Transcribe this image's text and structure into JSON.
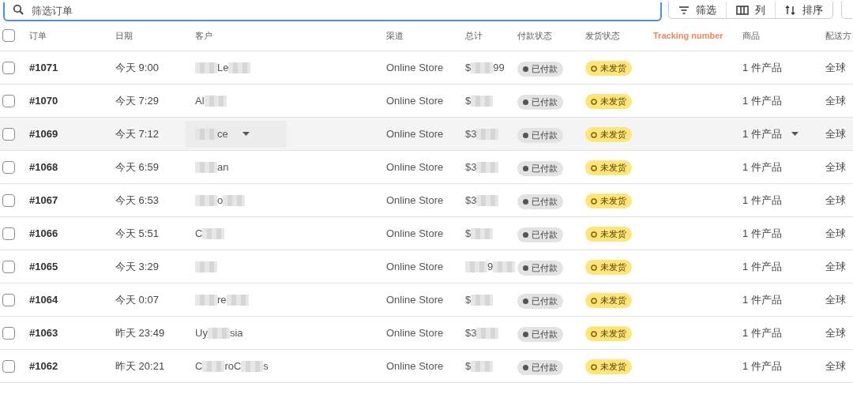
{
  "toolbar": {
    "search": {
      "placeholder": "筛选订单"
    },
    "buttons": [
      {
        "kind": "filter",
        "label": "筛选"
      },
      {
        "kind": "columns",
        "label": "列"
      },
      {
        "kind": "sort",
        "label": "排序"
      },
      {
        "kind": "more"
      }
    ]
  },
  "table": {
    "select_all": {
      "checked": false
    },
    "columns": [
      {
        "label": "订单",
        "highlight": false
      },
      {
        "label": "日期",
        "highlight": false
      },
      {
        "label": "客户",
        "highlight": false
      },
      {
        "label": "渠道",
        "highlight": false
      },
      {
        "label": "总计",
        "highlight": false
      },
      {
        "label": "付款状态",
        "highlight": false
      },
      {
        "label": "发货状态",
        "highlight": false
      },
      {
        "label": "Tracking number",
        "highlight": true
      },
      {
        "label": "商品",
        "highlight": false
      },
      {
        "label": "配送方",
        "highlight": false
      }
    ],
    "rows": [
      {
        "order": "#1071",
        "date": "今天 9:00",
        "customer": [
          {
            "kind": "blur"
          },
          {
            "kind": "text",
            "text": "Le"
          },
          {
            "kind": "blur"
          }
        ],
        "channel": "Online Store",
        "total": [
          {
            "kind": "text",
            "text": "$"
          },
          {
            "kind": "blur"
          },
          {
            "kind": "text",
            "text": "99"
          }
        ],
        "payment": "已付款",
        "fulfillment": "未发货",
        "items": "1 件产品",
        "shipping": "全球",
        "hovered": false,
        "checked": false
      },
      {
        "order": "#1070",
        "date": "今天 7:29",
        "customer": [
          {
            "kind": "text",
            "text": "Al"
          },
          {
            "kind": "blur"
          }
        ],
        "channel": "Online Store",
        "total": [
          {
            "kind": "text",
            "text": "$"
          },
          {
            "kind": "blur"
          }
        ],
        "payment": "已付款",
        "fulfillment": "未发货",
        "items": "1 件产品",
        "shipping": "全球",
        "hovered": false,
        "checked": false
      },
      {
        "order": "#1069",
        "date": "今天 7:12",
        "customer": [
          {
            "kind": "blur"
          },
          {
            "kind": "text",
            "text": "ce"
          }
        ],
        "channel": "Online Store",
        "total": [
          {
            "kind": "text",
            "text": "$3"
          },
          {
            "kind": "blur"
          }
        ],
        "payment": "已付款",
        "fulfillment": "未发货",
        "items": "1 件产品",
        "shipping": "全球",
        "hovered": true,
        "checked": false
      },
      {
        "order": "#1068",
        "date": "今天 6:59",
        "customer": [
          {
            "kind": "blur"
          },
          {
            "kind": "text",
            "text": "an"
          }
        ],
        "channel": "Online Store",
        "total": [
          {
            "kind": "text",
            "text": "$3"
          },
          {
            "kind": "blur"
          }
        ],
        "payment": "已付款",
        "fulfillment": "未发货",
        "items": "1 件产品",
        "shipping": "全球",
        "hovered": false,
        "checked": false
      },
      {
        "order": "#1067",
        "date": "今天 6:53",
        "customer": [
          {
            "kind": "blur"
          },
          {
            "kind": "text",
            "text": "o"
          },
          {
            "kind": "blur"
          }
        ],
        "channel": "Online Store",
        "total": [
          {
            "kind": "text",
            "text": "$3"
          },
          {
            "kind": "blur"
          }
        ],
        "payment": "已付款",
        "fulfillment": "未发货",
        "items": "1 件产品",
        "shipping": "全球",
        "hovered": false,
        "checked": false
      },
      {
        "order": "#1066",
        "date": "今天 5:51",
        "customer": [
          {
            "kind": "text",
            "text": "C"
          },
          {
            "kind": "blur"
          }
        ],
        "channel": "Online Store",
        "total": [
          {
            "kind": "text",
            "text": "$"
          },
          {
            "kind": "blur"
          }
        ],
        "payment": "已付款",
        "fulfillment": "未发货",
        "items": "1 件产品",
        "shipping": "全球",
        "hovered": false,
        "checked": false
      },
      {
        "order": "#1065",
        "date": "今天 3:29",
        "customer": [
          {
            "kind": "blur"
          }
        ],
        "channel": "Online Store",
        "total": [
          {
            "kind": "blur"
          },
          {
            "kind": "text",
            "text": "9"
          },
          {
            "kind": "blur"
          }
        ],
        "payment": "已付款",
        "fulfillment": "未发货",
        "items": "1 件产品",
        "shipping": "全球",
        "hovered": false,
        "checked": false
      },
      {
        "order": "#1064",
        "date": "今天 0:07",
        "customer": [
          {
            "kind": "blur"
          },
          {
            "kind": "text",
            "text": "re"
          },
          {
            "kind": "blur"
          }
        ],
        "channel": "Online Store",
        "total": [
          {
            "kind": "text",
            "text": "$"
          },
          {
            "kind": "blur"
          }
        ],
        "payment": "已付款",
        "fulfillment": "未发货",
        "items": "1 件产品",
        "shipping": "全球",
        "hovered": false,
        "checked": false
      },
      {
        "order": "#1063",
        "date": "昨天 23:49",
        "customer": [
          {
            "kind": "text",
            "text": "Uy"
          },
          {
            "kind": "blur"
          },
          {
            "kind": "text",
            "text": "sia"
          }
        ],
        "channel": "Online Store",
        "total": [
          {
            "kind": "text",
            "text": "$3"
          },
          {
            "kind": "blur"
          }
        ],
        "payment": "已付款",
        "fulfillment": "未发货",
        "items": "1 件产品",
        "shipping": "全球",
        "hovered": false,
        "checked": false
      },
      {
        "order": "#1062",
        "date": "昨天 20:21",
        "customer": [
          {
            "kind": "text",
            "text": "C"
          },
          {
            "kind": "blur"
          },
          {
            "kind": "text",
            "text": "roC"
          },
          {
            "kind": "blur"
          },
          {
            "kind": "text",
            "text": "s"
          }
        ],
        "channel": "Online Store",
        "total": [
          {
            "kind": "text",
            "text": "$"
          },
          {
            "kind": "blur"
          }
        ],
        "payment": "已付款",
        "fulfillment": "未发货",
        "items": "1 件产品",
        "shipping": "全球",
        "hovered": false,
        "checked": false
      }
    ]
  }
}
